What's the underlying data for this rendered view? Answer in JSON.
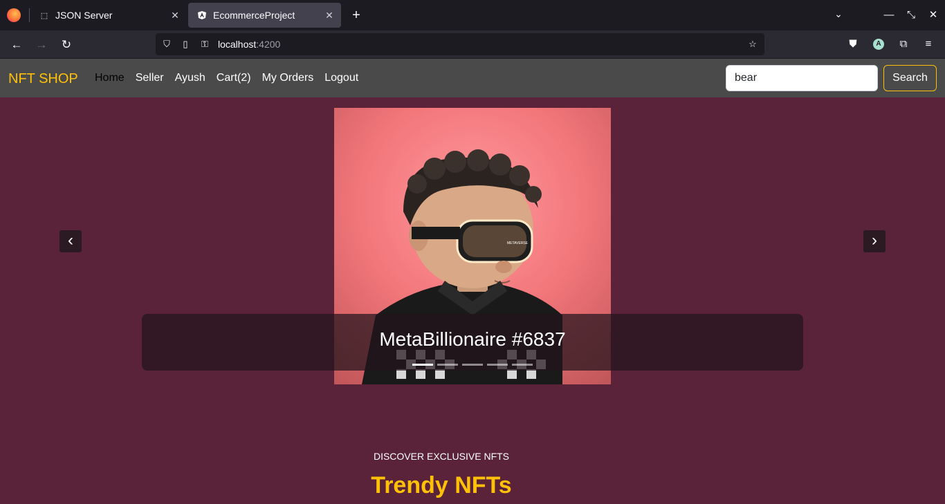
{
  "browser": {
    "tabs": [
      {
        "title": "JSON Server",
        "active": false
      },
      {
        "title": "EcommerceProject",
        "active": true
      }
    ],
    "url": {
      "host": "localhost",
      "port": ":4200"
    },
    "account_initial": "A"
  },
  "site": {
    "brand": "NFT SHOP",
    "menu": [
      "Home",
      "Seller",
      "Ayush",
      "Cart(2)",
      "My Orders",
      "Logout"
    ],
    "search": {
      "value": "bear",
      "button": "Search"
    }
  },
  "carousel": {
    "caption": "MetaBillionaire #6837",
    "slide_count": 5,
    "active_slide": 1,
    "visor_text": "METAVERSE"
  },
  "section": {
    "kicker": "DISCOVER EXCLUSIVE NFTS",
    "title": "Trendy NFTs"
  },
  "colors": {
    "page_bg": "#5a2339",
    "header_bg": "#4a4a4a",
    "accent": "#ffc107"
  }
}
